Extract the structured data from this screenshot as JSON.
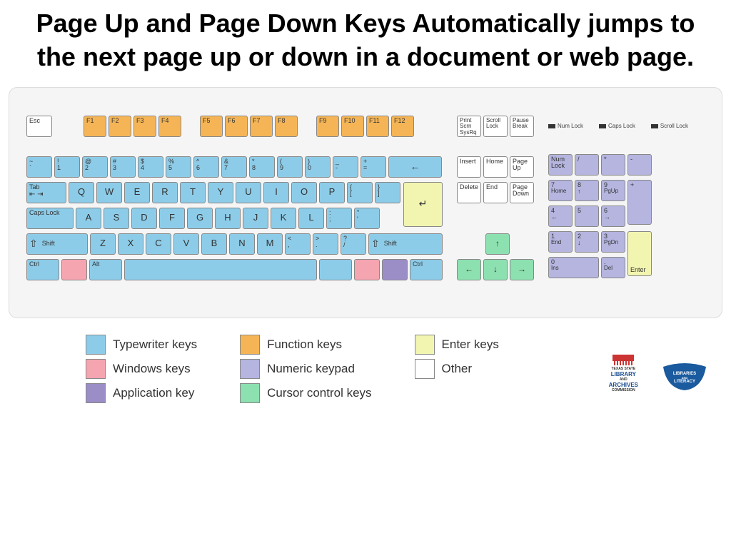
{
  "title": "Page Up and Page Down Keys Automatically jumps to the next page up or down in a document or web page.",
  "frow": [
    "F1",
    "F2",
    "F3",
    "F4",
    "F5",
    "F6",
    "F7",
    "F8",
    "F9",
    "F10",
    "F11",
    "F12"
  ],
  "esc": "Esc",
  "sys": {
    "print": "Print Scrn",
    "sysrq": "SysRq",
    "scroll": "Scroll Lock",
    "pause": "Pause",
    "break": "Break"
  },
  "ind": {
    "num": "Num Lock",
    "caps": "Caps Lock",
    "scroll": "Scroll Lock"
  },
  "numrow_top": [
    "~",
    "!",
    "@",
    "#",
    "$",
    "%",
    "^",
    "&",
    "*",
    "(",
    ")",
    "_",
    "+"
  ],
  "numrow_bot": [
    "`",
    "1",
    "2",
    "3",
    "4",
    "5",
    "6",
    "7",
    "8",
    "9",
    "0",
    "-",
    "="
  ],
  "backspace": "←",
  "tab": "Tab",
  "qrow": [
    "Q",
    "W",
    "E",
    "R",
    "T",
    "Y",
    "U",
    "I",
    "O",
    "P"
  ],
  "brackets": {
    "lt": "{",
    "lb": "[",
    "rt": "}",
    "rb": "]"
  },
  "caps": "Caps Lock",
  "arow": [
    "A",
    "S",
    "D",
    "F",
    "G",
    "H",
    "J",
    "K",
    "L"
  ],
  "semi": {
    "t": ":",
    "b": ";"
  },
  "quote": {
    "t": "\"",
    "b": "'"
  },
  "enter": "↵",
  "shift": "Shift",
  "zrow": [
    "Z",
    "X",
    "C",
    "V",
    "B",
    "N",
    "M"
  ],
  "comma": {
    "t": "<",
    "b": ","
  },
  "period": {
    "t": ">",
    "b": "."
  },
  "slash": {
    "t": "?",
    "b": "/"
  },
  "ctrl": "Ctrl",
  "alt": "Alt",
  "nav": {
    "insert": "Insert",
    "home": "Home",
    "pgup": "Page Up",
    "delete": "Delete",
    "end": "End",
    "pgdn": "Page Down"
  },
  "arrows": {
    "up": "↑",
    "down": "↓",
    "left": "←",
    "right": "→"
  },
  "numpad": {
    "numlock": "Num Lock",
    "div": "/",
    "mul": "*",
    "sub": "-",
    "7": "7",
    "home": "Home",
    "8": "8",
    "up": "↑",
    "9": "9",
    "pgup": "PgUp",
    "add": "+",
    "4": "4",
    "left": "←",
    "5": "5",
    "6": "6",
    "right": "→",
    "1": "1",
    "end": "End",
    "2": "2",
    "down": "↓",
    "3": "3",
    "pgdn": "PgDn",
    "enter": "Enter",
    "0": "0",
    "ins": "Ins",
    "dot": ".",
    "del": "Del"
  },
  "legend": {
    "type": "Typewriter keys",
    "win": "Windows keys",
    "app": "Application key",
    "func": "Function keys",
    "num": "Numeric keypad",
    "cursor": "Cursor control keys",
    "enter": "Enter keys",
    "other": "Other"
  },
  "logo1": {
    "main": "LIBRARY",
    "sub": "ARCHIVES",
    "top": "TEXAS STATE",
    "bot": "COMMISSION"
  },
  "logo2": {
    "main": "LIBRARIES",
    "sub": "LITERACY",
    "mid": "AND"
  }
}
